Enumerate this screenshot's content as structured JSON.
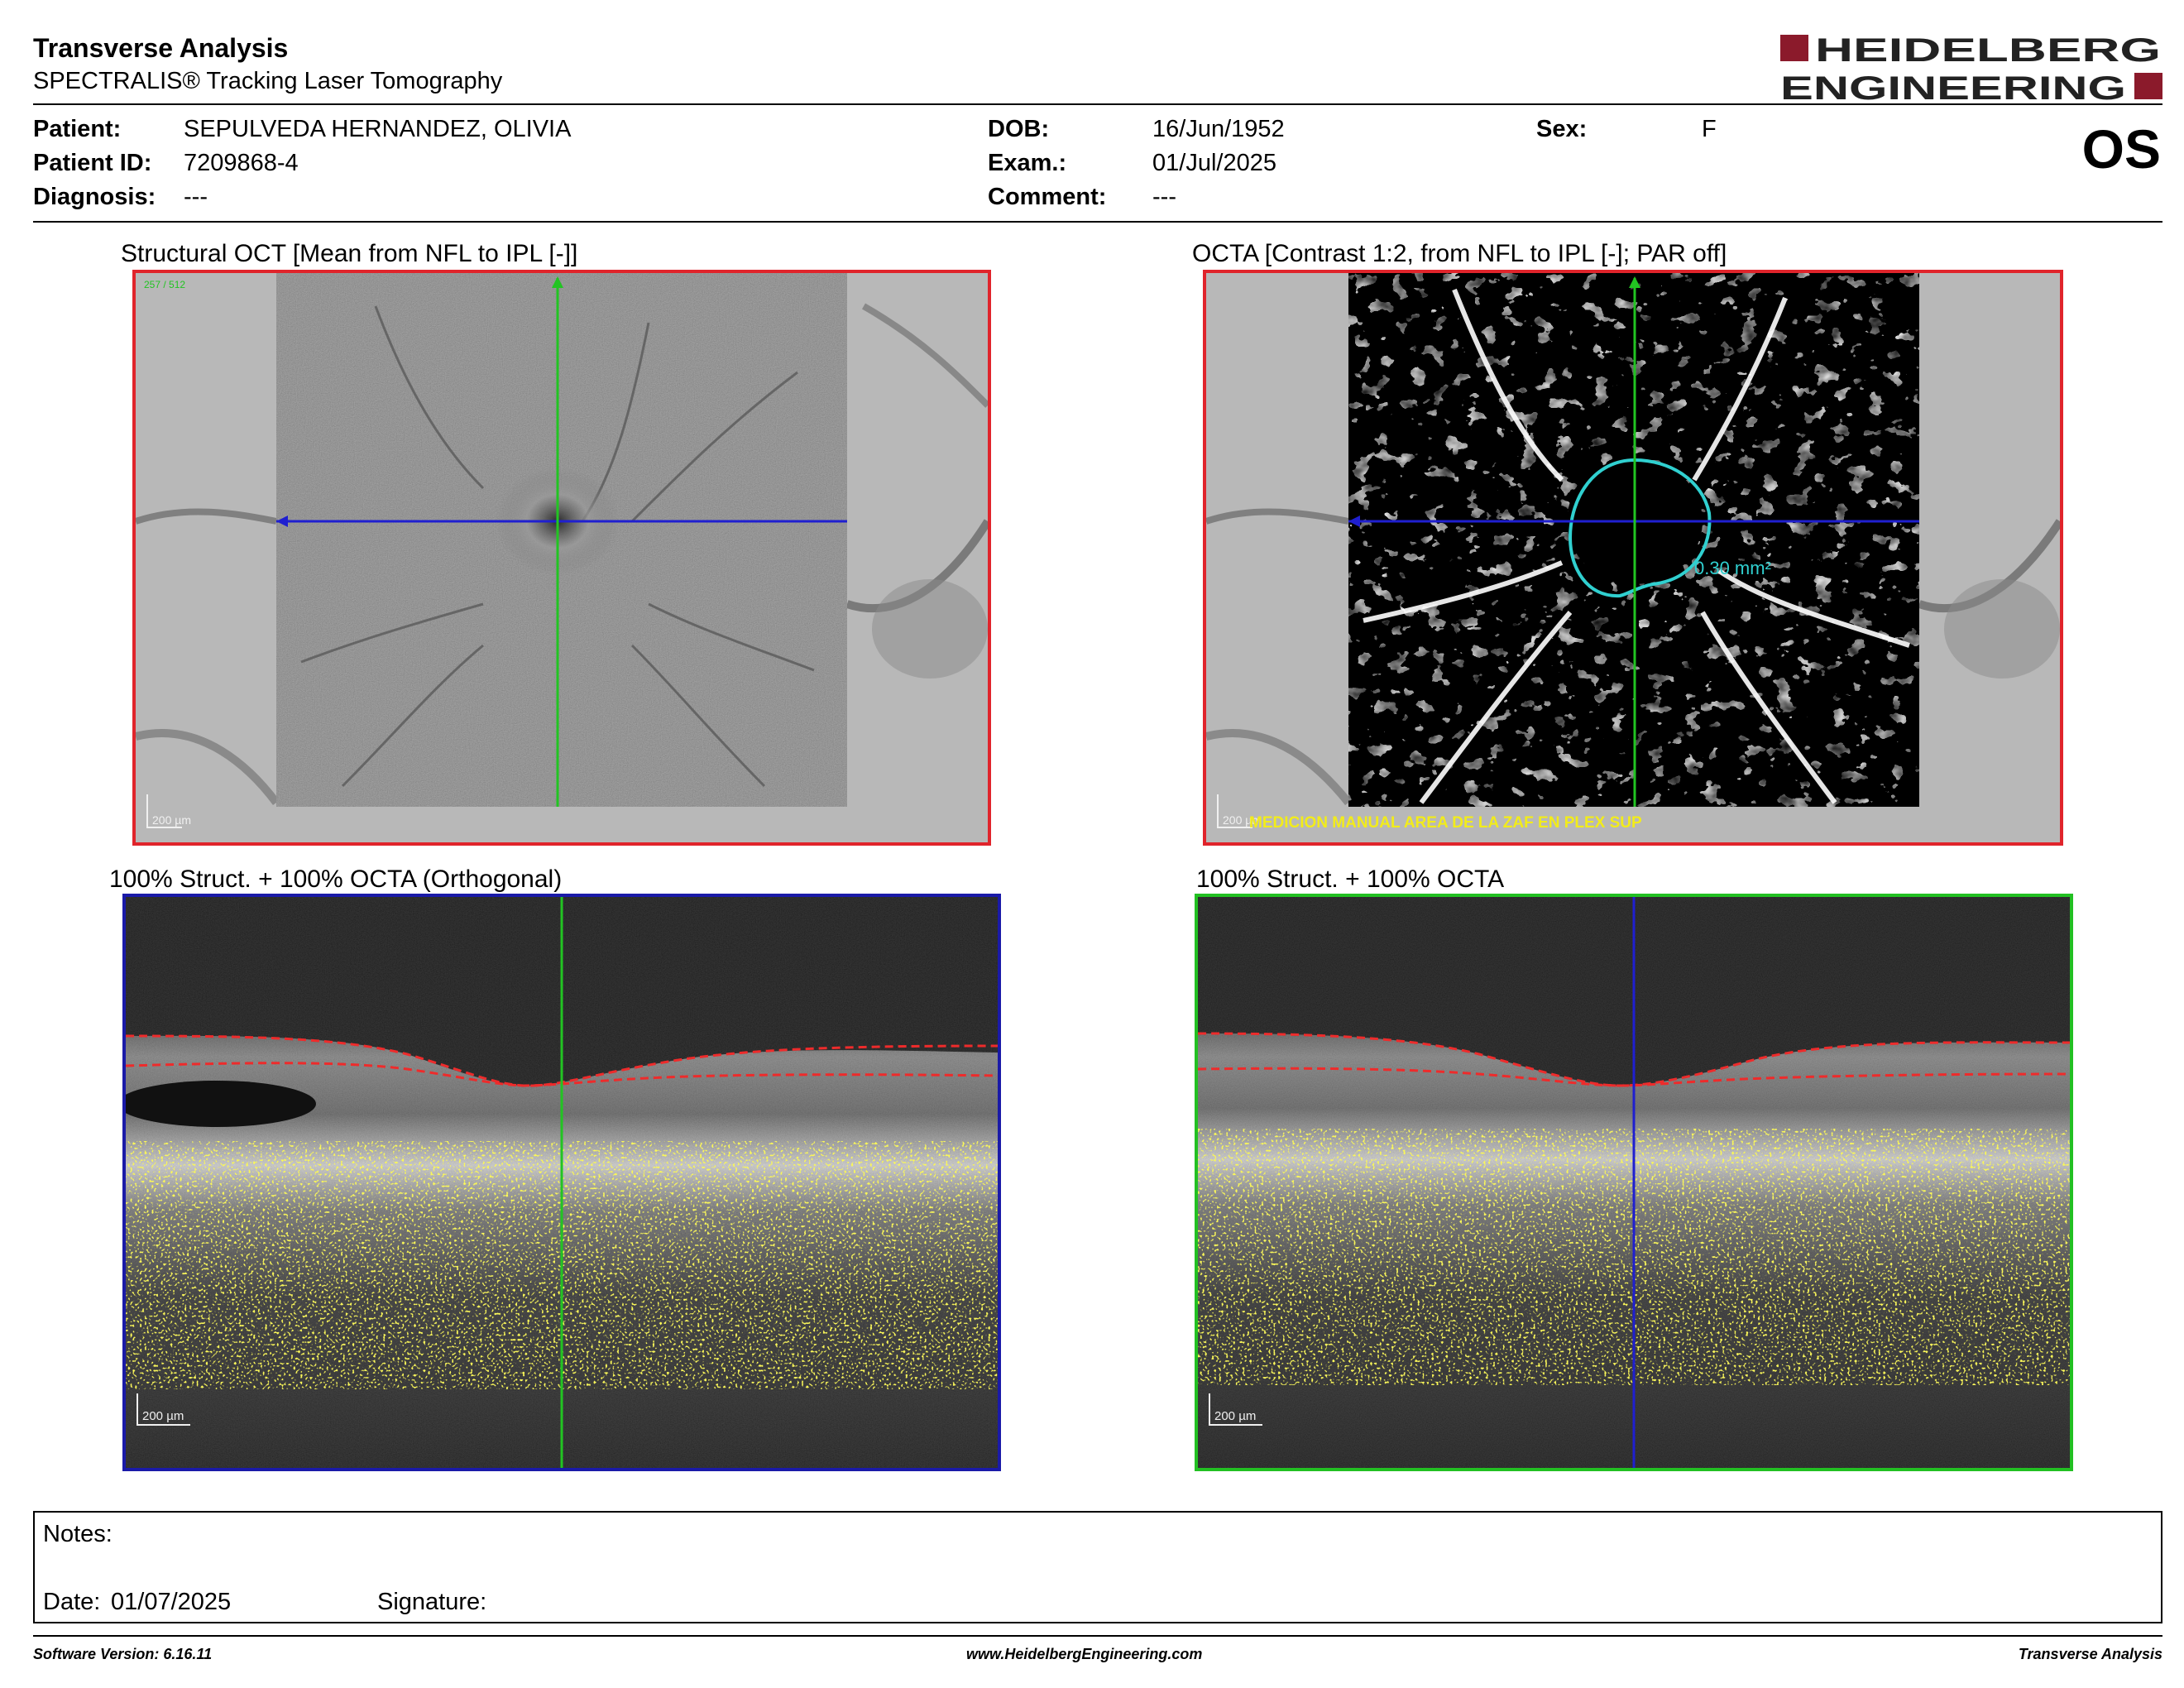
{
  "header": {
    "title": "Transverse Analysis",
    "subtitle": "SPECTRALIS® Tracking Laser Tomography",
    "logo": {
      "line1": "HEIDELBERG",
      "line2": "ENGINEERING",
      "accent": "#8b1a2b"
    },
    "eye": "OS"
  },
  "patient": {
    "patient_label": "Patient:",
    "patient_value": "SEPULVEDA HERNANDEZ, OLIVIA",
    "id_label": "Patient ID:",
    "id_value": "7209868-4",
    "diagnosis_label": "Diagnosis:",
    "diagnosis_value": "---",
    "dob_label": "DOB:",
    "dob_value": "16/Jun/1952",
    "exam_label": "Exam.:",
    "exam_value": "01/Jul/2025",
    "comment_label": "Comment:",
    "comment_value": "---",
    "sex_label": "Sex:",
    "sex_value": "F"
  },
  "panels": {
    "structural": {
      "title": "Structural OCT [Mean from NFL to IPL [-]]",
      "frame_label": "257 / 512",
      "scale": "200 µm"
    },
    "octa": {
      "title": "OCTA [Contrast 1:2, from NFL to IPL [-]; PAR off]",
      "area": "0.30 mm²",
      "annotation": "MEDICION MANUAL AREA DE LA ZAF EN PLEX SUP",
      "scale": "200 µm"
    },
    "orthogonal": {
      "title": "100% Struct. + 100% OCTA (Orthogonal)",
      "scale": "200 µm"
    },
    "bscan": {
      "title": "100% Struct. + 100% OCTA",
      "scale": "200 µm"
    }
  },
  "colors": {
    "frame_red": "#e0242b",
    "frame_blue": "#1a1aa8",
    "frame_green": "#22c022",
    "line_green": "#22c422",
    "line_blue": "#1f1fd0",
    "faz": "#30d0d0",
    "flow": "#f2ec1a"
  },
  "notes": {
    "notes_label": "Notes:",
    "date_label": "Date:",
    "date_value": "01/07/2025",
    "signature_label": "Signature:"
  },
  "footer": {
    "left": "Software Version: 6.16.11",
    "center": "www.HeidelbergEngineering.com",
    "right": "Transverse Analysis"
  }
}
